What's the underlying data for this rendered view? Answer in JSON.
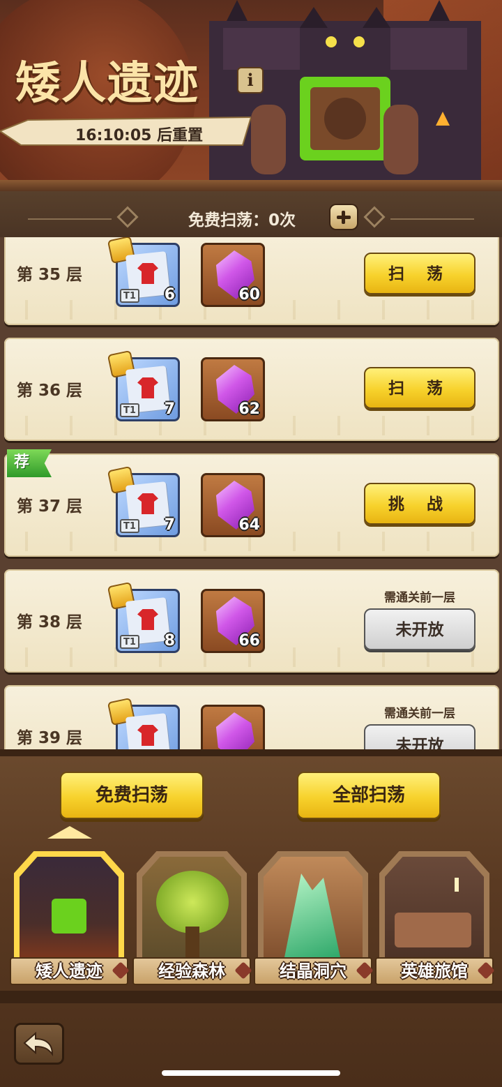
{
  "header": {
    "title": "矮人遗迹",
    "info_icon": "i",
    "reset_text": "16:10:05 后重置"
  },
  "sweep_bar": {
    "label": "免费扫荡：0次",
    "plus_icon": "plus-icon"
  },
  "floors": [
    {
      "label": "第 35 层",
      "scroll_qty": "6",
      "scroll_tier": "T1",
      "crystal_qty": "60",
      "action": "扫 荡",
      "state": "sweep"
    },
    {
      "label": "第 36 层",
      "scroll_qty": "7",
      "scroll_tier": "T1",
      "crystal_qty": "62",
      "action": "扫 荡",
      "state": "sweep"
    },
    {
      "label": "第 37 层",
      "scroll_qty": "7",
      "scroll_tier": "T1",
      "crystal_qty": "64",
      "action": "挑 战",
      "state": "challenge",
      "badge": "荐"
    },
    {
      "label": "第 38 层",
      "scroll_qty": "8",
      "scroll_tier": "T1",
      "crystal_qty": "66",
      "action": "未开放",
      "state": "locked",
      "requirement": "需通关前一层"
    },
    {
      "label": "第 39 层",
      "scroll_qty": "",
      "scroll_tier": "",
      "crystal_qty": "",
      "action": "未开放",
      "state": "locked",
      "requirement": "需通关前一层"
    }
  ],
  "actions": {
    "free_sweep": "免费扫荡",
    "sweep_all": "全部扫荡"
  },
  "dungeons": [
    {
      "label": "矮人遗迹",
      "selected": true
    },
    {
      "label": "经验森林",
      "selected": false
    },
    {
      "label": "结晶洞穴",
      "selected": false
    },
    {
      "label": "英雄旅馆",
      "selected": false
    }
  ],
  "colors": {
    "accent_yellow": "#f7d22c",
    "card_bg": "#f7f0dc",
    "recommend_green": "#2f9a2a",
    "crystal_purple": "#d057e8"
  }
}
